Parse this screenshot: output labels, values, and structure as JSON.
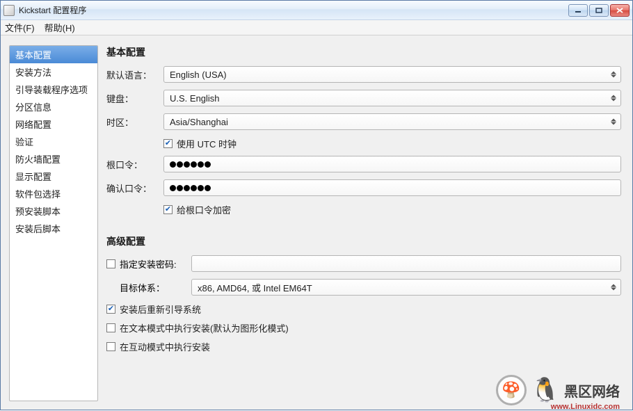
{
  "title": "Kickstart 配置程序",
  "menu": {
    "file": "文件(F)",
    "help": "帮助(H)"
  },
  "sidebar": {
    "items": [
      "基本配置",
      "安装方法",
      "引导装载程序选项",
      "分区信息",
      "网络配置",
      "验证",
      "防火墙配置",
      "显示配置",
      "软件包选择",
      "预安装脚本",
      "安装后脚本"
    ],
    "selected_index": 0
  },
  "basic": {
    "heading": "基本配置",
    "labels": {
      "language": "默认语言：",
      "keyboard": "键盘：",
      "timezone": "时区：",
      "rootpw": "根口令：",
      "confirmpw": "确认口令："
    },
    "values": {
      "language": "English (USA)",
      "keyboard": "U.S. English",
      "timezone": "Asia/Shanghai"
    },
    "utc_label": "使用 UTC 时钟",
    "utc_checked": true,
    "encrypt_pw_label": "给根口令加密",
    "encrypt_pw_checked": true
  },
  "advanced": {
    "heading": "高级配置",
    "install_key_label": "指定安装密码:",
    "install_key_checked": false,
    "install_key_value": "",
    "arch_label": "目标体系：",
    "arch_value": "x86, AMD64, 或 Intel EM64T",
    "options": [
      {
        "label": "安装后重新引导系统",
        "checked": true
      },
      {
        "label": "在文本模式中执行安装(默认为图形化模式)",
        "checked": false
      },
      {
        "label": "在互动模式中执行安装",
        "checked": false
      }
    ]
  },
  "watermark": {
    "text": "黑区网络",
    "url": "www.Linuxidc.com"
  }
}
